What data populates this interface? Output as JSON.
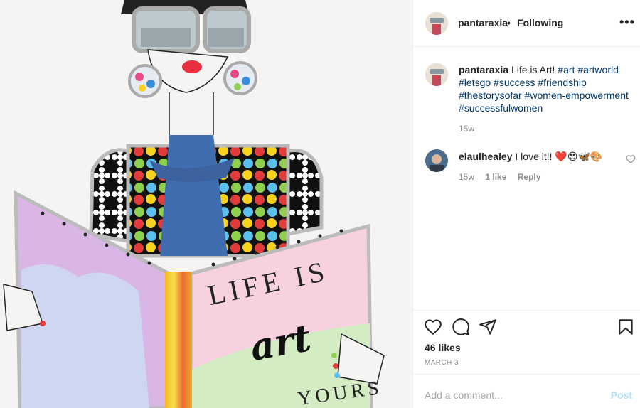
{
  "post": {
    "username": "pantaraxia",
    "separator": "•",
    "follow_status": "Following",
    "more_label": "•••"
  },
  "artwork": {
    "book_title_line1": "LIFE IS",
    "book_title_line2": "art",
    "book_title_line3": "YOURS"
  },
  "caption": {
    "username": "pantaraxia",
    "text": "Life is Art!",
    "hashtags": [
      "#art",
      "#artworld",
      "#letsgo",
      "#success",
      "#friendship",
      "#thestorysofar",
      "#women-empowerment",
      "#successfulwomen"
    ],
    "time": "15w"
  },
  "comments": [
    {
      "username": "elaulhealey",
      "text": "I love it!! ❤️😍🦋🎨",
      "time": "15w",
      "likes": "1 like",
      "reply": "Reply"
    }
  ],
  "actions": {
    "icons": [
      "heart-icon",
      "comment-icon",
      "share-icon",
      "bookmark-icon"
    ],
    "likes": "46 likes",
    "date": "MARCH 3"
  },
  "add_comment": {
    "placeholder": "Add a comment...",
    "post_label": "Post"
  },
  "colors": {
    "hashtag": "#00376b",
    "muted": "#8e8e8e",
    "post_disabled": "#b2dffc"
  }
}
